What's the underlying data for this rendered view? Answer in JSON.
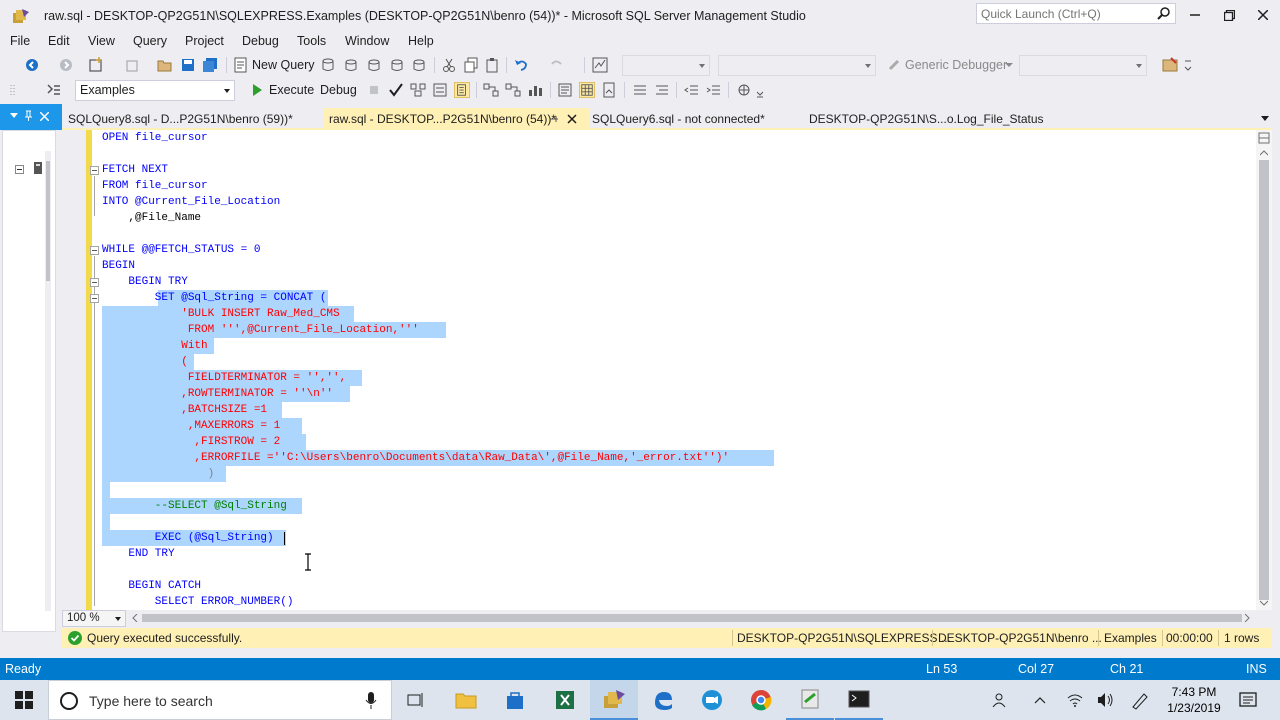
{
  "window": {
    "title": "raw.sql - DESKTOP-QP2G51N\\SQLEXPRESS.Examples (DESKTOP-QP2G51N\\benro (54))* - Microsoft SQL Server Management Studio",
    "quick_launch_placeholder": "Quick Launch (Ctrl+Q)"
  },
  "menu": [
    "File",
    "Edit",
    "View",
    "Query",
    "Project",
    "Debug",
    "Tools",
    "Window",
    "Help"
  ],
  "toolbar1": {
    "new_query": "New Query",
    "debugger": "Generic Debugger"
  },
  "toolbar2": {
    "database": "Examples",
    "execute": "Execute",
    "debug": "Debug"
  },
  "tabs": [
    {
      "label": "SQLQuery8.sql - D...P2G51N\\benro (59))*"
    },
    {
      "label": "raw.sql - DESKTOP...P2G51N\\benro (54))*"
    },
    {
      "label": "SQLQuery6.sql - not connected*"
    },
    {
      "label": "DESKTOP-QP2G51N\\S...o.Log_File_Status"
    }
  ],
  "editor": {
    "lines": [
      "OPEN file_cursor",
      "",
      "FETCH NEXT",
      "FROM file_cursor",
      "INTO @Current_File_Location",
      "    ,@File_Name",
      "",
      "WHILE @@FETCH_STATUS = 0",
      "BEGIN",
      "    BEGIN TRY",
      "        SET @Sql_String = CONCAT (",
      "            'BULK INSERT Raw_Med_CMS",
      "             FROM ''',@Current_File_Location,'''",
      "            With",
      "            (",
      "             FIELDTERMINATOR = '','',",
      "            ,ROWTERMINATOR = ''\\n''",
      "            ,BATCHSIZE =1",
      "             ,MAXERRORS = 1",
      "              ,FIRSTROW = 2",
      "              ,ERRORFILE =''C:\\Users\\benro\\Documents\\data\\Raw_Data\\',@File_Name,'_error.txt'')'",
      "                )",
      "",
      "        --SELECT @Sql_String",
      "",
      "        EXEC (@Sql_String)",
      "    END TRY",
      "",
      "    BEGIN CATCH",
      "        SELECT ERROR_NUMBER()"
    ]
  },
  "zoom": "100 %",
  "query_status": {
    "message": "Query executed successfully.",
    "server": "DESKTOP-QP2G51N\\SQLEXPRESS ...",
    "user": "DESKTOP-QP2G51N\\benro ...",
    "database": "Examples",
    "elapsed": "00:00:00",
    "rows": "1 rows"
  },
  "statusbar": {
    "state": "Ready",
    "ln": "Ln 53",
    "col": "Col 27",
    "ch": "Ch 21",
    "mode": "INS"
  },
  "taskbar": {
    "search_placeholder": "Type here to search",
    "time": "7:43 PM",
    "date": "1/23/2019"
  },
  "colors": {
    "accent": "#007acc",
    "tab_active": "#fff0b5",
    "selection": "#add6ff",
    "keyword": "#0000ff",
    "string": "#ff0000",
    "function": "#ff00ff",
    "comment": "#008000"
  }
}
